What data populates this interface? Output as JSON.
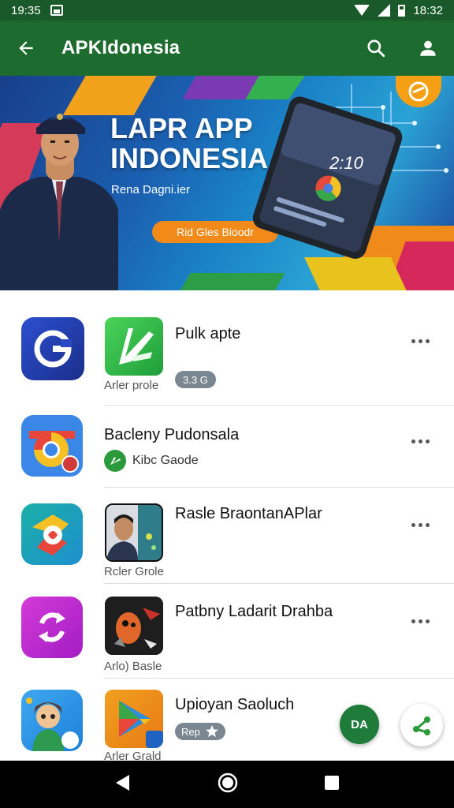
{
  "status_bar": {
    "time_left": "19:35",
    "time_right": "18:32"
  },
  "app_bar": {
    "title": "APKIdonesia"
  },
  "banner": {
    "title_line1": "LAPR APP",
    "title_line2": "INDONESIA",
    "subtitle": "Rena Dagni.ier",
    "cta": "Rid Gles Bioodr",
    "phone_clock": "2:10"
  },
  "apps": [
    {
      "title": "Pulk apte",
      "subtitle": "Arler prole",
      "chip": "3.3 G",
      "chip_type": "badge"
    },
    {
      "title": "Bacleny Pudonsala",
      "subtitle": "",
      "chip": "Kibc Gaode",
      "chip_type": "brand"
    },
    {
      "title": "Rasle BraontanAPlar",
      "subtitle": "Rcler Grole",
      "chip": "",
      "chip_type": "none"
    },
    {
      "title": "Patbny Ladarit Drahba",
      "subtitle": "Arlo) Basle",
      "chip": "",
      "chip_type": "none"
    },
    {
      "title": "Upioyan Saoluch",
      "subtitle": "Arler Grald",
      "chip": "Rep",
      "chip_type": "badge"
    }
  ],
  "fab": {
    "label": "DA"
  },
  "colors": {
    "app_bar": "#1e6b30",
    "status_bar": "#1a5a2a",
    "accent_orange": "#f28a1a"
  }
}
